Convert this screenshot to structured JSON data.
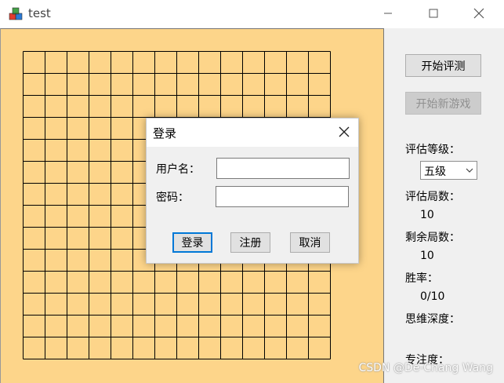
{
  "window": {
    "title": "test",
    "icons": {
      "app": "app-cubes-icon",
      "minimize": "minimize-icon",
      "maximize": "maximize-icon",
      "close": "close-icon"
    }
  },
  "board": {
    "rows": 14,
    "cols": 14,
    "color": "#fdd58a",
    "line_color": "#000000"
  },
  "side": {
    "start_eval_button": "开始评测",
    "new_game_button": "开始新游戏",
    "eval_level_label": "评估等级：",
    "eval_level_value": "五级",
    "eval_games_label": "评估局数：",
    "eval_games_value": "10",
    "remaining_games_label": "剩余局数：",
    "remaining_games_value": "10",
    "win_rate_label": "胜率：",
    "win_rate_value": "0/10",
    "thinking_depth_label": "思维深度：",
    "focus_label": "专注度："
  },
  "dialog": {
    "title": "登录",
    "username_label": "用户名：",
    "username_value": "",
    "password_label": "密码：",
    "password_value": "",
    "login_button": "登录",
    "register_button": "注册",
    "cancel_button": "取消",
    "accent_color": "#0078d7"
  },
  "watermark": "CSDN @De-Chang Wang"
}
